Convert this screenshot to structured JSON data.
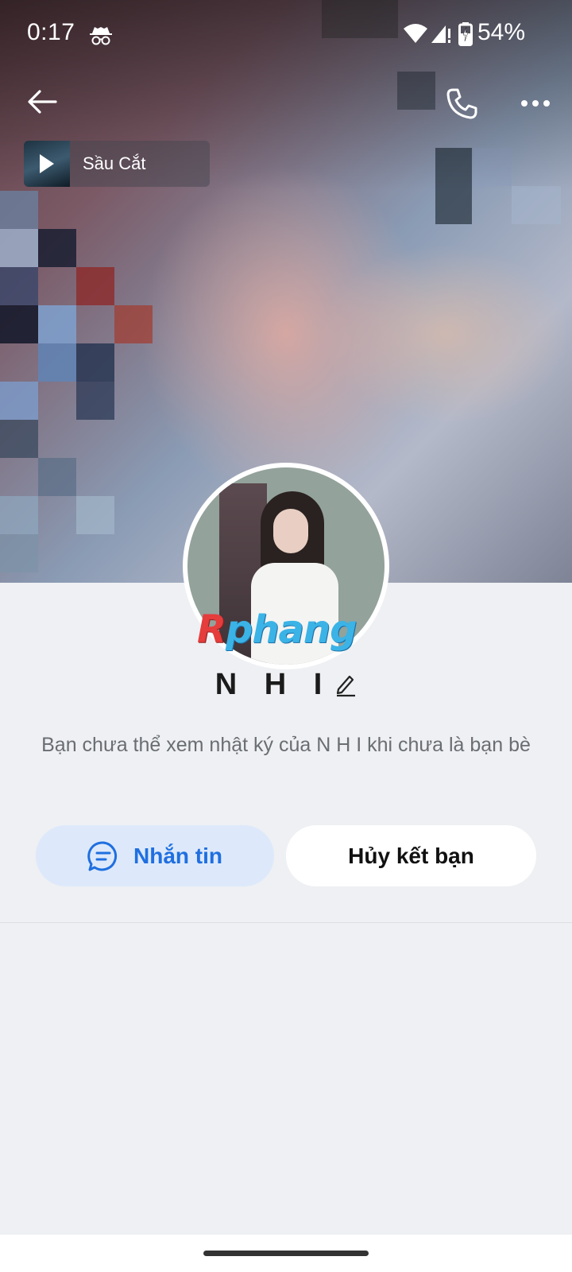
{
  "status_bar": {
    "time": "0:17",
    "battery": "54%"
  },
  "music": {
    "marquee": "Sầu  Cắt"
  },
  "watermark": {
    "part1": "R",
    "part2": "phang"
  },
  "profile": {
    "name": "N H I",
    "privacy_note": "Bạn chưa thể xem nhật ký của N H I khi chưa là bạn bè"
  },
  "actions": {
    "message_label": "Nhắn tin",
    "unfriend_label": "Hủy kết bạn"
  },
  "colors": {
    "accent": "#1f6fe0",
    "message_bg": "#dde9fb",
    "page_bg": "#eef0f3"
  },
  "icons": [
    "incognito-icon",
    "wifi-icon",
    "signal-icon",
    "battery-icon",
    "back-arrow-icon",
    "phone-icon",
    "more-icon",
    "play-icon",
    "edit-icon",
    "chat-icon"
  ]
}
